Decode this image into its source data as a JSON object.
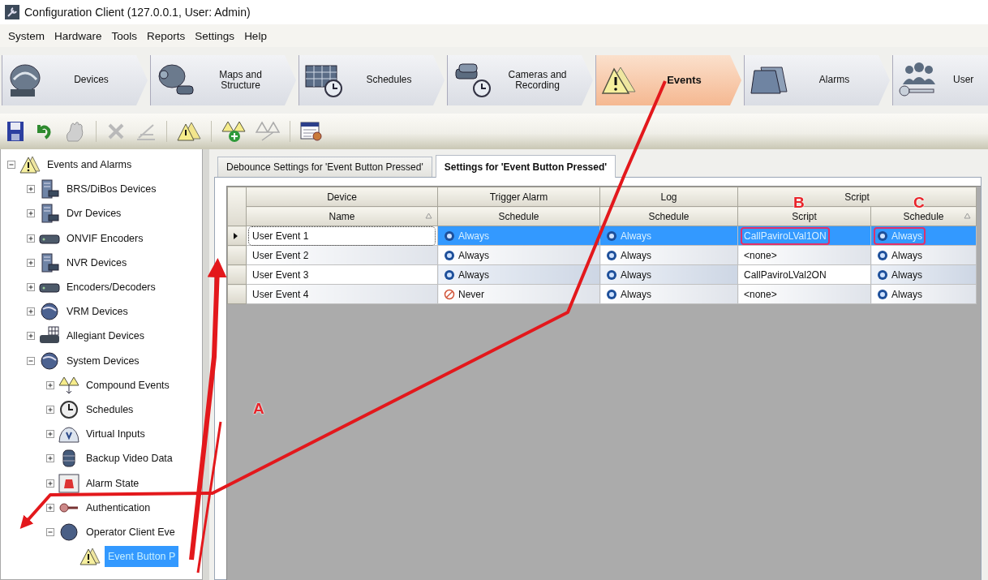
{
  "window": {
    "title": "Configuration Client (127.0.0.1, User: Admin)"
  },
  "menu": [
    "System",
    "Hardware",
    "Tools",
    "Reports",
    "Settings",
    "Help"
  ],
  "nav": [
    {
      "label": "Devices",
      "selected": false
    },
    {
      "label": "Maps and Structure",
      "selected": false
    },
    {
      "label": "Schedules",
      "selected": false
    },
    {
      "label": "Cameras and Recording",
      "selected": false
    },
    {
      "label": "Events",
      "selected": true
    },
    {
      "label": "Alarms",
      "selected": false
    },
    {
      "label": "User",
      "selected": false
    }
  ],
  "tree": [
    {
      "label": "Events and Alarms",
      "expanded": true,
      "selected": false,
      "children": [
        {
          "label": "BRS/DiBos Devices",
          "expanded": false,
          "selected": false
        },
        {
          "label": "Dvr Devices",
          "expanded": false,
          "selected": false
        },
        {
          "label": "ONVIF Encoders",
          "expanded": false,
          "selected": false
        },
        {
          "label": "NVR Devices",
          "expanded": false,
          "selected": false
        },
        {
          "label": "Encoders/Decoders",
          "expanded": false,
          "selected": false
        },
        {
          "label": "VRM Devices",
          "expanded": false,
          "selected": false
        },
        {
          "label": "Allegiant Devices",
          "expanded": false,
          "selected": false
        },
        {
          "label": "System Devices",
          "expanded": true,
          "selected": false,
          "children": [
            {
              "label": "Compound Events",
              "expanded": false,
              "selected": false
            },
            {
              "label": "Schedules",
              "expanded": false,
              "selected": false
            },
            {
              "label": "Virtual Inputs",
              "expanded": false,
              "selected": false
            },
            {
              "label": "Backup Video Data",
              "expanded": false,
              "selected": false
            },
            {
              "label": "Alarm State",
              "expanded": false,
              "selected": false
            },
            {
              "label": "Authentication",
              "expanded": false,
              "selected": false
            },
            {
              "label": "Operator Client Eve",
              "expanded": true,
              "selected": false,
              "children": [
                {
                  "label": "Event Button P",
                  "selected": true
                }
              ]
            }
          ]
        }
      ]
    }
  ],
  "tabs": [
    {
      "label": "Debounce Settings for 'Event Button Pressed'",
      "selected": false
    },
    {
      "label": "Settings for 'Event Button Pressed'",
      "selected": true
    }
  ],
  "grid": {
    "groups": [
      {
        "label": "Device",
        "columns": [
          {
            "label": "Name",
            "sorted": true
          }
        ]
      },
      {
        "label": "Trigger Alarm",
        "columns": [
          {
            "label": "Schedule",
            "sorted": false
          }
        ]
      },
      {
        "label": "Log",
        "columns": [
          {
            "label": "Schedule",
            "sorted": false
          }
        ]
      },
      {
        "label": "Script",
        "columns": [
          {
            "label": "Script",
            "sorted": false
          },
          {
            "label": "Schedule",
            "sorted": true
          }
        ]
      }
    ],
    "rows": [
      {
        "current": true,
        "selected": true,
        "cells": [
          {
            "kind": "text",
            "text": "User Event 1",
            "highlighted": false
          },
          {
            "kind": "always",
            "text": "Always",
            "highlighted": false
          },
          {
            "kind": "always",
            "text": "Always",
            "highlighted": false
          },
          {
            "kind": "text",
            "text": "CallPaviroLVal1ON",
            "highlighted": true
          },
          {
            "kind": "always",
            "text": "Always",
            "highlighted": true
          }
        ]
      },
      {
        "current": false,
        "selected": false,
        "cells": [
          {
            "kind": "text",
            "text": "User Event 2",
            "highlighted": false
          },
          {
            "kind": "always",
            "text": "Always",
            "highlighted": false
          },
          {
            "kind": "always",
            "text": "Always",
            "highlighted": false
          },
          {
            "kind": "text",
            "text": "<none>",
            "highlighted": false
          },
          {
            "kind": "always",
            "text": "Always",
            "highlighted": false
          }
        ]
      },
      {
        "current": false,
        "selected": false,
        "cells": [
          {
            "kind": "text",
            "text": "User Event 3",
            "highlighted": false
          },
          {
            "kind": "always",
            "text": "Always",
            "highlighted": false
          },
          {
            "kind": "always",
            "text": "Always",
            "highlighted": false
          },
          {
            "kind": "text",
            "text": "CallPaviroLVal2ON",
            "highlighted": false
          },
          {
            "kind": "always",
            "text": "Always",
            "highlighted": false
          }
        ]
      },
      {
        "current": false,
        "selected": false,
        "cells": [
          {
            "kind": "text",
            "text": "User Event 4",
            "highlighted": false
          },
          {
            "kind": "never",
            "text": "Never",
            "highlighted": false
          },
          {
            "kind": "always",
            "text": "Always",
            "highlighted": false
          },
          {
            "kind": "text",
            "text": "<none>",
            "highlighted": false
          },
          {
            "kind": "always",
            "text": "Always",
            "highlighted": false
          }
        ]
      }
    ]
  },
  "annotations": {
    "labels": [
      "A",
      "B",
      "C"
    ]
  }
}
